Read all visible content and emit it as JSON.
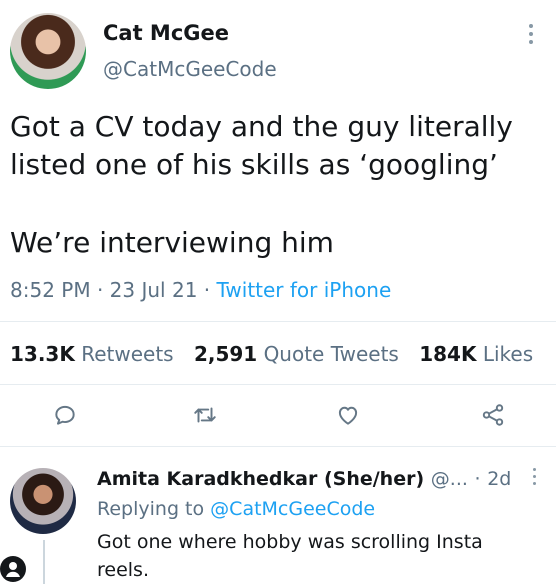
{
  "tweet": {
    "author_name": "Cat McGee",
    "author_handle": "@CatMcGeeCode",
    "text_lines": [
      "Got a CV today and the guy literally listed one of his skills as ‘googling’",
      "We’re interviewing him"
    ],
    "time": "8:52 PM",
    "date": "23 Jul 21",
    "separator": "·",
    "source": "Twitter for iPhone",
    "stats": {
      "retweets_count": "13.3K",
      "retweets_label": "Retweets",
      "quotes_count": "2,591",
      "quotes_label": "Quote Tweets",
      "likes_count": "184K",
      "likes_label": "Likes"
    },
    "actions": [
      "reply-icon",
      "retweet-icon",
      "like-icon",
      "share-icon"
    ]
  },
  "reply": {
    "author_name": "Amita Karadkhedkar (She/her)",
    "author_handle": "@...",
    "separator": "·",
    "time": "2d",
    "replying_prefix": "Replying to",
    "replying_to": "@CatMcGeeCode",
    "text": "Got one where hobby was scrolling Insta reels."
  },
  "colors": {
    "text": "#14171a",
    "secondary": "#5b7083",
    "link": "#1da1f2",
    "divider": "#e6ecf0"
  }
}
